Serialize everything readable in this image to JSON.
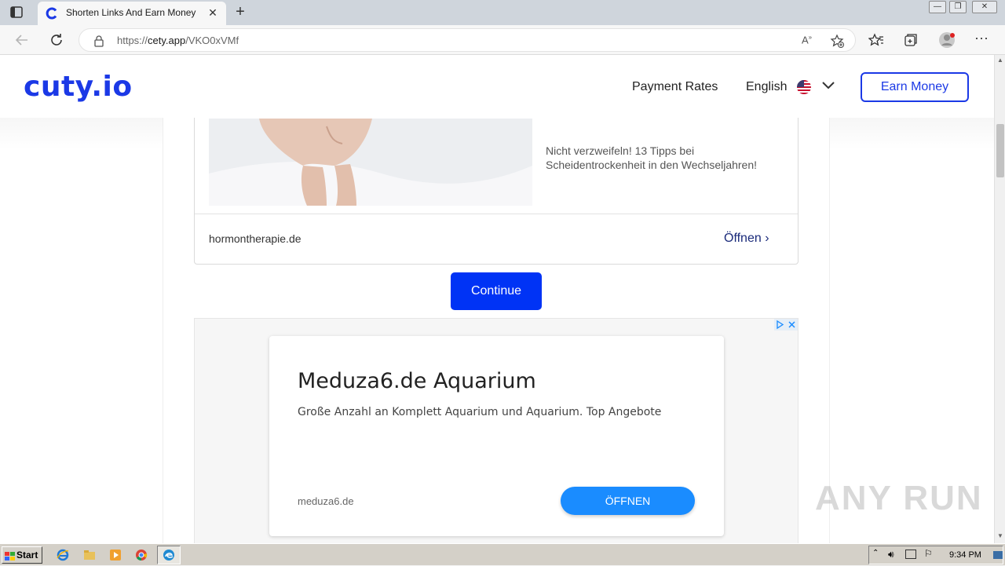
{
  "browser": {
    "tab_title": "Shorten Links And Earn Money | c",
    "url_prefix": "https://",
    "url_host": "cety.app",
    "url_path": "/VKO0xVMf",
    "new_tab_label": "+",
    "close_tab_label": "✕"
  },
  "site": {
    "logo": "cuty.io",
    "nav": {
      "payment_rates": "Payment Rates",
      "language": "English"
    },
    "earn_button": "Earn Money",
    "brand_color": "#1b39e6"
  },
  "ad1": {
    "headline": "Nicht verzweifeln! 13 Tipps bei Scheidentrockenheit in den Wechseljahren!",
    "domain": "hormontherapie.de",
    "open_label": "Öffnen ›"
  },
  "continue_label": "Continue",
  "ad2": {
    "title": "Meduza6.de Aquarium",
    "description": "Große Anzahl an Komplett Aquarium und Aquarium. Top Angebote",
    "domain": "meduza6.de",
    "open_label": "ÖFFNEN"
  },
  "watermark": "ANY RUN",
  "taskbar": {
    "start_label": "Start",
    "clock": "9:34 PM"
  }
}
